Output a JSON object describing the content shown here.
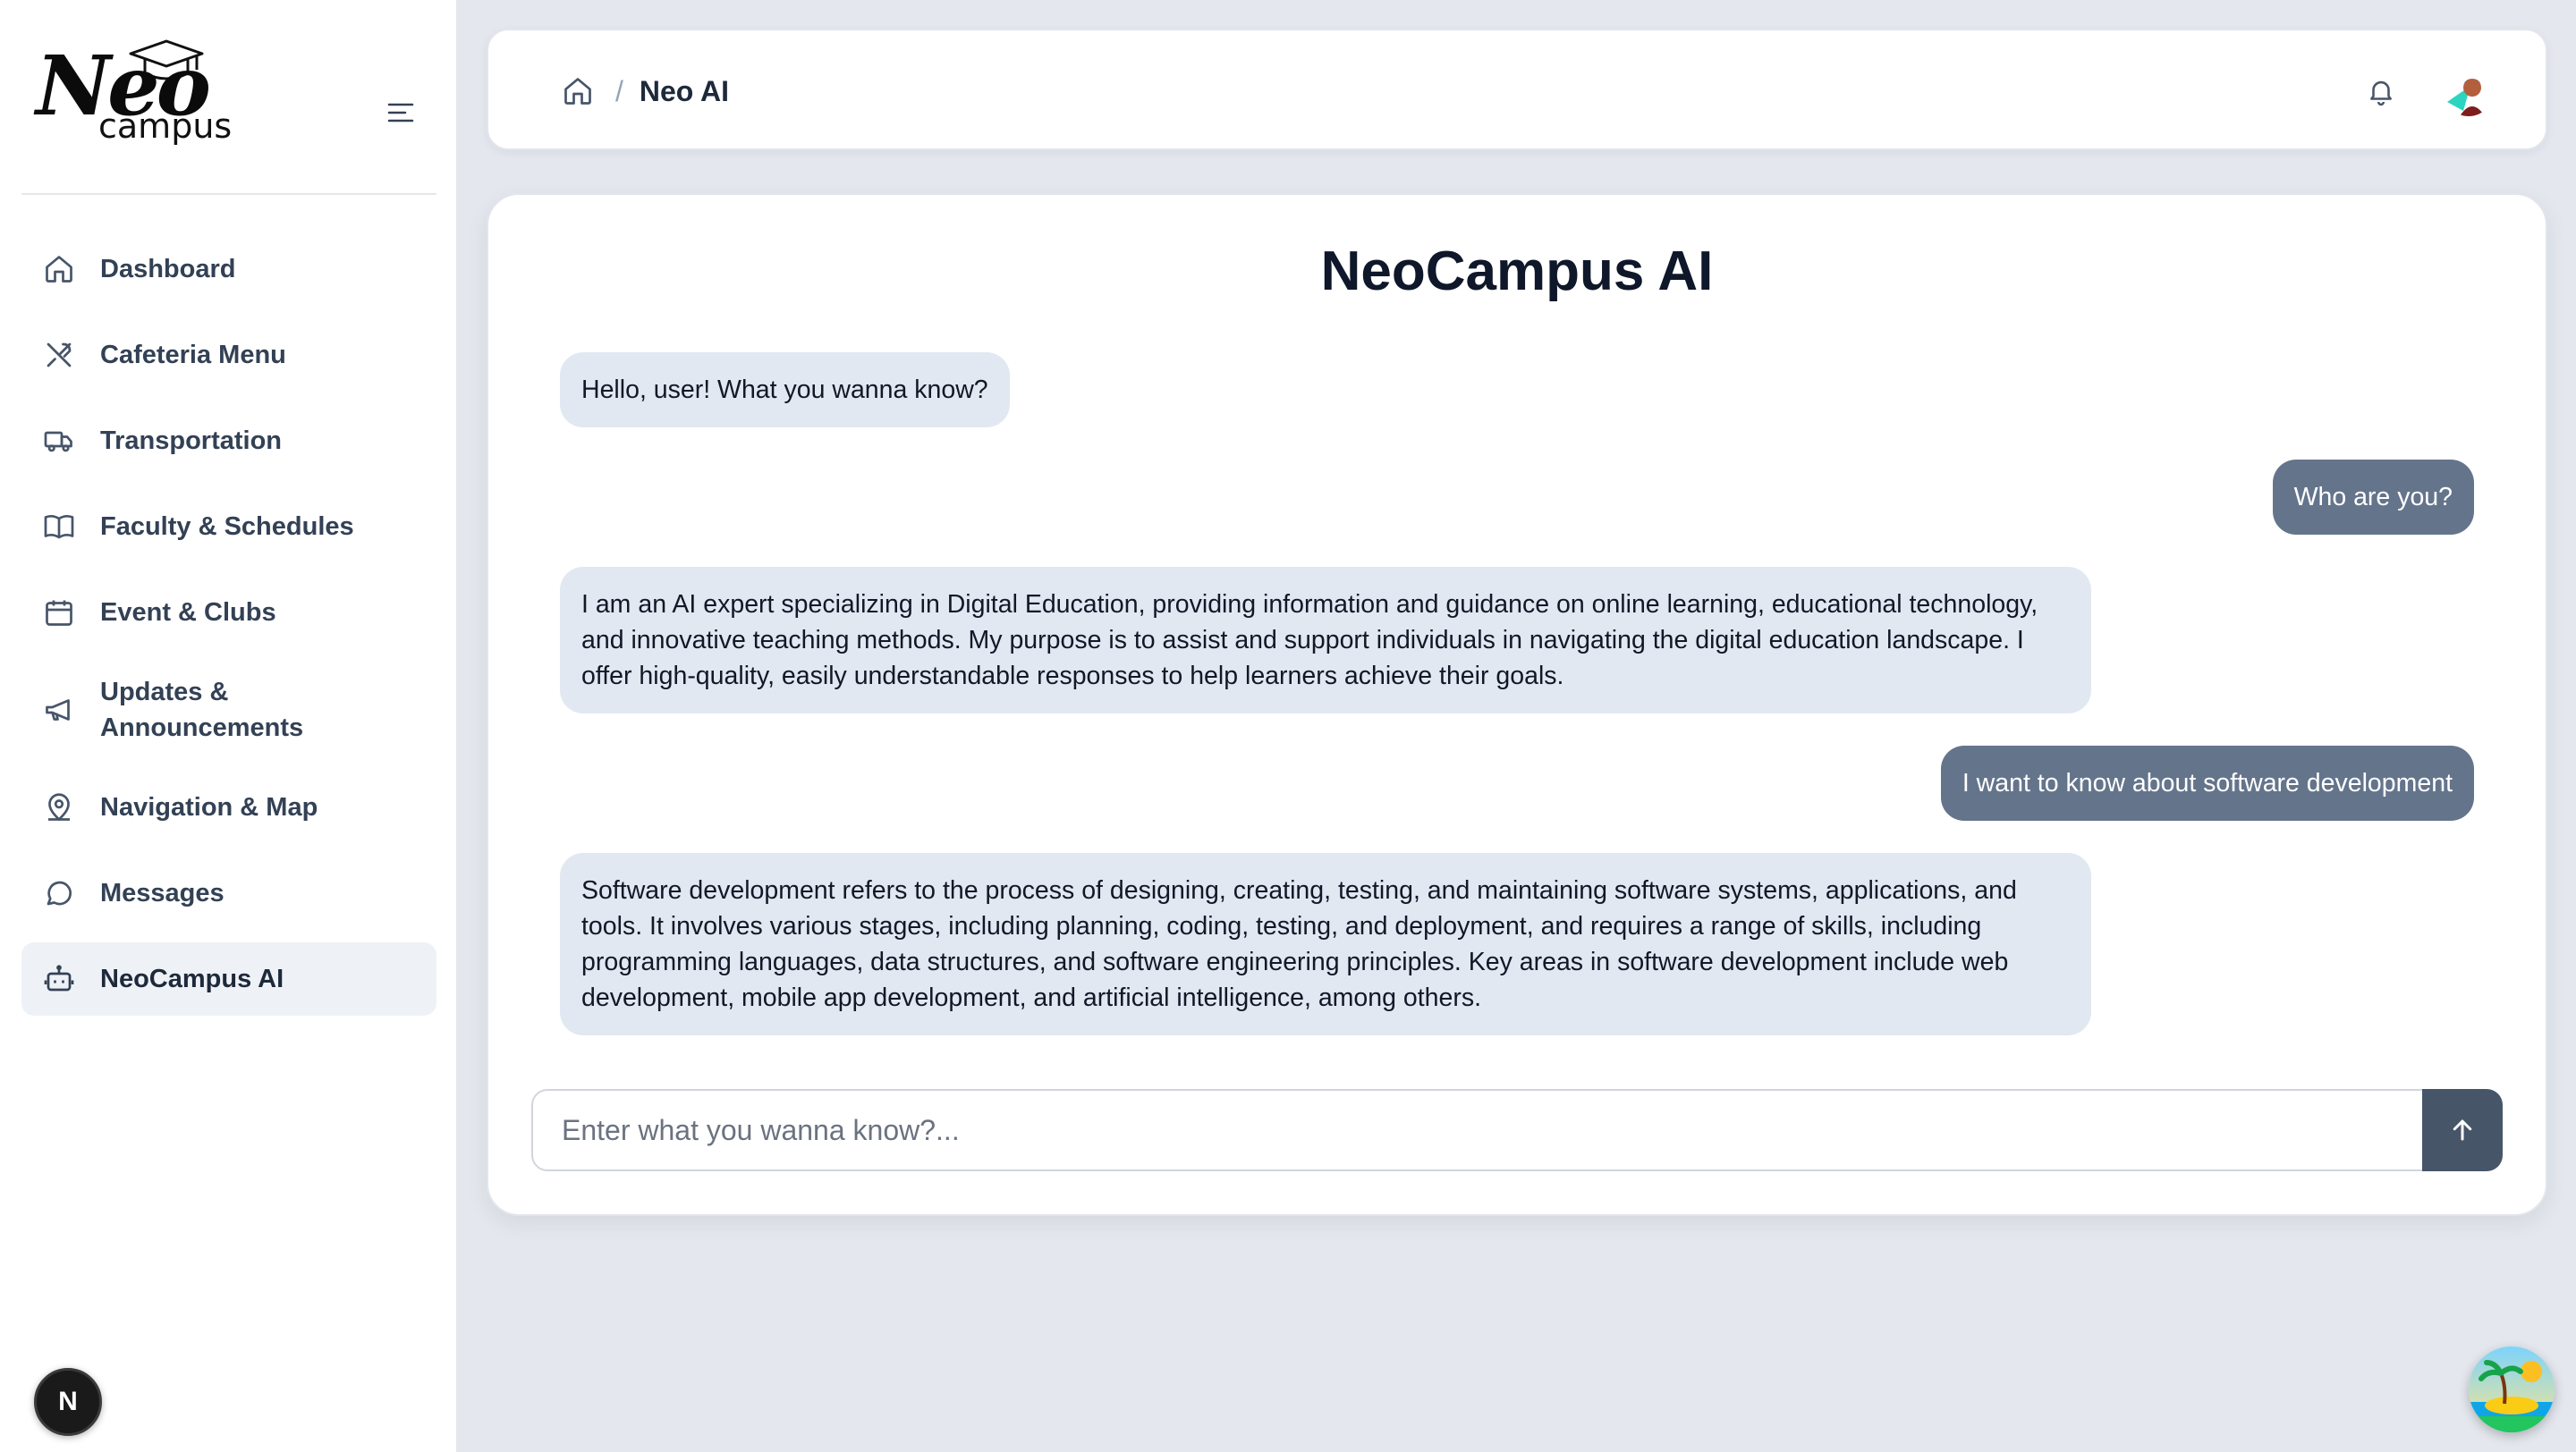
{
  "app": {
    "logo_main": "Neo",
    "logo_sub": "campus"
  },
  "sidebar": {
    "items": [
      {
        "label": "Dashboard",
        "icon": "home-icon"
      },
      {
        "label": "Cafeteria Menu",
        "icon": "utensils-icon"
      },
      {
        "label": "Transportation",
        "icon": "truck-icon"
      },
      {
        "label": "Faculty & Schedules",
        "icon": "book-icon"
      },
      {
        "label": "Event & Clubs",
        "icon": "calendar-icon"
      },
      {
        "label": "Updates & Announcements",
        "icon": "megaphone-icon"
      },
      {
        "label": "Navigation & Map",
        "icon": "map-pin-icon"
      },
      {
        "label": "Messages",
        "icon": "chat-bubble-icon"
      },
      {
        "label": "NeoCampus AI",
        "icon": "bot-icon",
        "active": true
      }
    ]
  },
  "header": {
    "breadcrumb_separator": "/",
    "breadcrumb_current": "Neo AI"
  },
  "chat": {
    "title": "NeoCampus AI",
    "messages": [
      {
        "role": "ai",
        "text": "Hello, user! What you wanna know?"
      },
      {
        "role": "user",
        "text": "Who are you?"
      },
      {
        "role": "ai",
        "text": "I am an AI expert specializing in Digital Education, providing information and guidance on online learning, educational technology, and innovative teaching methods. My purpose is to assist and support individuals in navigating the digital education landscape. I offer high-quality, easily understandable responses to help learners achieve their goals."
      },
      {
        "role": "user",
        "text": "I want to know about software development"
      },
      {
        "role": "ai",
        "text": "Software development refers to the process of designing, creating, testing, and maintaining software systems, applications, and tools. It involves various stages, including planning, coding, testing, and deployment, and requires a range of skills, including programming languages, data structures, and software engineering principles. Key areas in software development include web development, mobile app development, and artificial intelligence, among others."
      }
    ],
    "input_placeholder": "Enter what you wanna know?...",
    "input_value": ""
  },
  "footer": {
    "dev_badge_label": "N"
  },
  "colors": {
    "accent": "#475569",
    "user_bubble": "#64748b",
    "ai_bubble": "#e2e8f1",
    "active_nav": "#eef2f7",
    "background": "#e4e8ee"
  }
}
